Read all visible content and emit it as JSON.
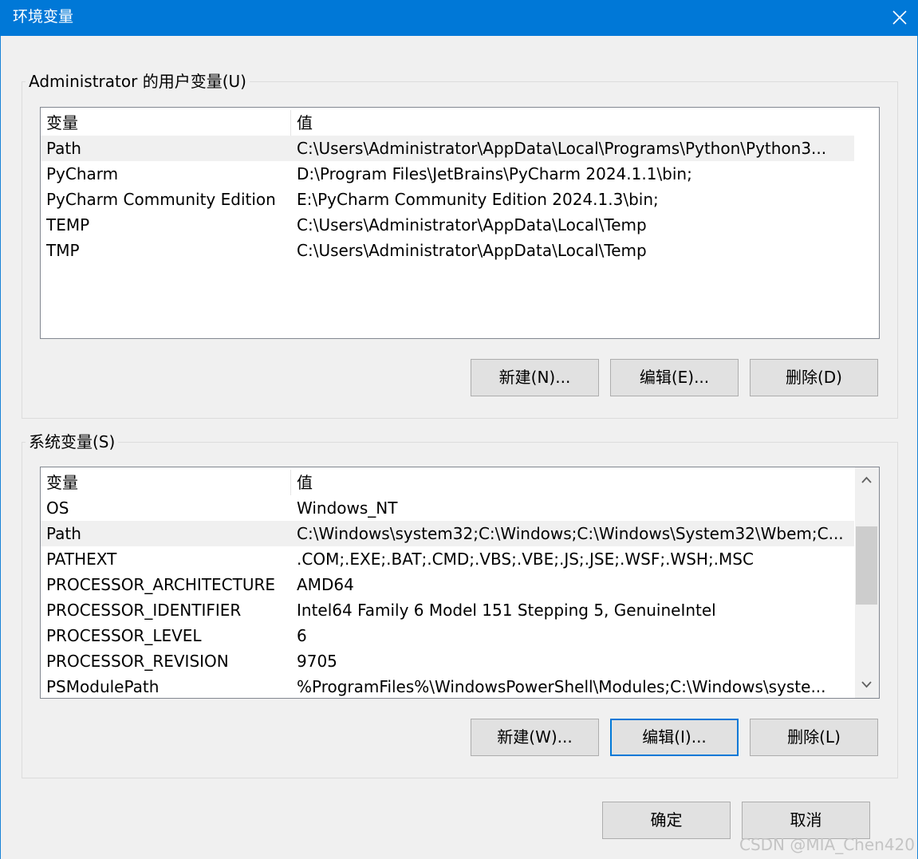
{
  "window": {
    "title": "环境变量",
    "accent": "#0078d7"
  },
  "user_vars": {
    "legend": "Administrator 的用户变量(U)",
    "columns": [
      "变量",
      "值"
    ],
    "rows": [
      {
        "name": "Path",
        "value": "C:\\Users\\Administrator\\AppData\\Local\\Programs\\Python\\Python3..."
      },
      {
        "name": "PyCharm",
        "value": "D:\\Program Files\\JetBrains\\PyCharm 2024.1.1\\bin;"
      },
      {
        "name": "PyCharm Community Edition",
        "value": "E:\\PyCharm Community Edition 2024.1.3\\bin;"
      },
      {
        "name": "TEMP",
        "value": "C:\\Users\\Administrator\\AppData\\Local\\Temp"
      },
      {
        "name": "TMP",
        "value": "C:\\Users\\Administrator\\AppData\\Local\\Temp"
      }
    ],
    "selected_index": 0,
    "buttons": {
      "new": "新建(N)...",
      "edit": "编辑(E)...",
      "delete": "删除(D)"
    }
  },
  "system_vars": {
    "legend": "系统变量(S)",
    "columns": [
      "变量",
      "值"
    ],
    "rows": [
      {
        "name": "OS",
        "value": "Windows_NT"
      },
      {
        "name": "Path",
        "value": "C:\\Windows\\system32;C:\\Windows;C:\\Windows\\System32\\Wbem;C..."
      },
      {
        "name": "PATHEXT",
        "value": ".COM;.EXE;.BAT;.CMD;.VBS;.VBE;.JS;.JSE;.WSF;.WSH;.MSC"
      },
      {
        "name": "PROCESSOR_ARCHITECTURE",
        "value": "AMD64"
      },
      {
        "name": "PROCESSOR_IDENTIFIER",
        "value": "Intel64 Family 6 Model 151 Stepping 5, GenuineIntel"
      },
      {
        "name": "PROCESSOR_LEVEL",
        "value": "6"
      },
      {
        "name": "PROCESSOR_REVISION",
        "value": "9705"
      },
      {
        "name": "PSModulePath",
        "value": "%ProgramFiles%\\WindowsPowerShell\\Modules;C:\\Windows\\syste..."
      }
    ],
    "selected_index": 1,
    "buttons": {
      "new": "新建(W)...",
      "edit": "编辑(I)...",
      "delete": "删除(L)"
    }
  },
  "footer": {
    "ok": "确定",
    "cancel": "取消"
  },
  "watermark": "CSDN @MIA_Chen420"
}
